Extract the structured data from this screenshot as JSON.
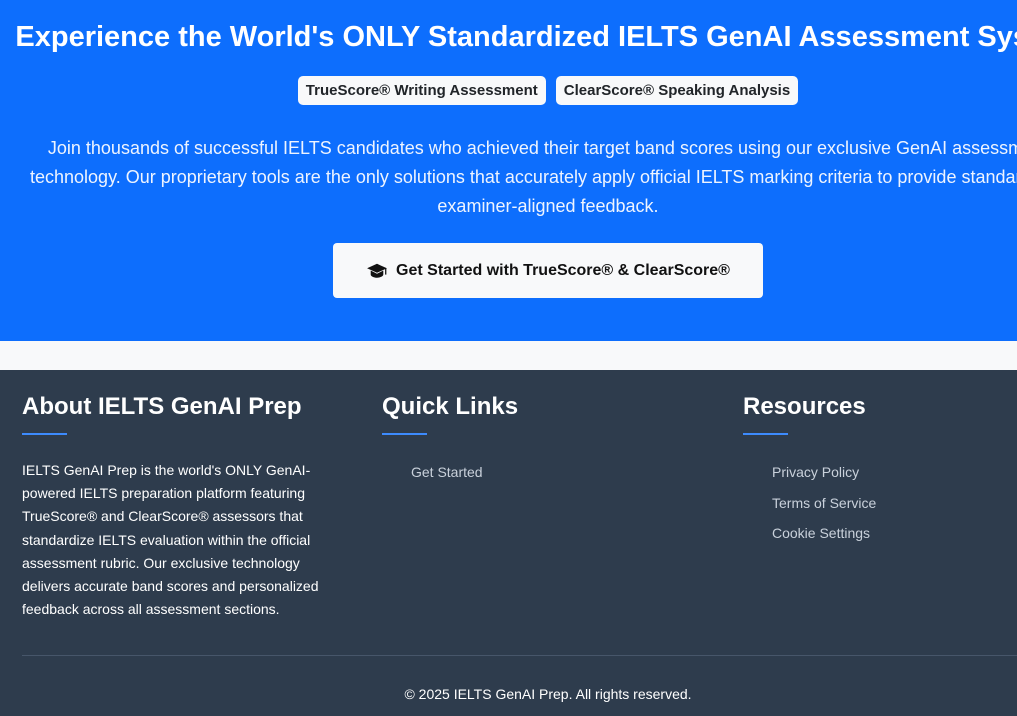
{
  "hero": {
    "title": "Experience the World's ONLY Standardized IELTS GenAI Assessment System",
    "badges": [
      "TrueScore® Writing Assessment",
      "ClearScore® Speaking Analysis"
    ],
    "description_lines": [
      "Join thousands of successful IELTS candidates who achieved their target band scores using our exclusive GenAI assessment",
      "technology. Our proprietary tools are the only solutions that accurately apply official IELTS marking criteria to provide standardized,",
      "examiner-aligned feedback."
    ],
    "cta_label": "Get Started with TrueScore® & ClearScore®",
    "cta_icon": "graduation-cap-icon"
  },
  "footer": {
    "about": {
      "heading": "About IELTS GenAI Prep",
      "text": "IELTS GenAI Prep is the world's ONLY GenAI-powered IELTS preparation platform featuring TrueScore® and ClearScore® assessors that standardize IELTS evaluation within the official assessment rubric. Our exclusive technology delivers accurate band scores and personalized feedback across all assessment sections."
    },
    "quick_links": {
      "heading": "Quick Links",
      "items": [
        "Get Started"
      ]
    },
    "resources": {
      "heading": "Resources",
      "items": [
        "Privacy Policy",
        "Terms of Service",
        "Cookie Settings"
      ]
    },
    "copyright": "© 2025 IELTS GenAI Prep. All rights reserved."
  },
  "colors": {
    "hero_bg": "#0d6efd",
    "footer_bg": "#2e3c4d",
    "accent_rule": "#3d8bfd"
  }
}
